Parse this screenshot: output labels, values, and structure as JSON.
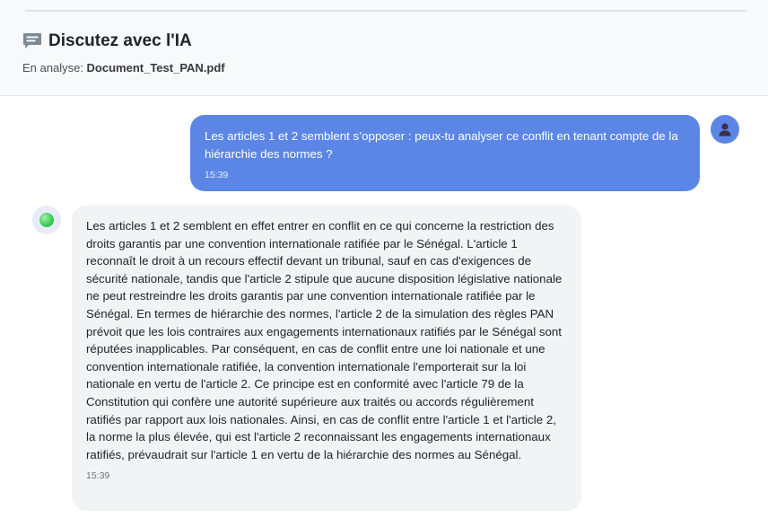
{
  "header": {
    "title": "Discutez avec l'IA",
    "analysis_label": "En analyse: ",
    "document_name": "Document_Test_PAN.pdf",
    "icon": "chat-icon"
  },
  "messages": [
    {
      "role": "user",
      "text": "Les articles 1 et 2 semblent s’opposer : peux-tu analyser ce conflit en tenant compte de la hiérarchie des normes ?",
      "time": "15:39",
      "avatar_icon": "user-avatar-icon"
    },
    {
      "role": "assistant",
      "text": "Les articles 1 et 2 semblent en effet entrer en conflit en ce qui concerne la restriction des droits garantis par une convention internationale ratifiée par le Sénégal. L'article 1 reconnaît le droit à un recours effectif devant un tribunal, sauf en cas d'exigences de sécurité nationale, tandis que l'article 2 stipule que aucune disposition législative nationale ne peut restreindre les droits garantis par une convention internationale ratifiée par le Sénégal. En termes de hiérarchie des normes, l'article 2 de la simulation des règles PAN prévoit que les lois contraires aux engagements internationaux ratifiés par le Sénégal sont réputées inapplicables. Par conséquent, en cas de conflit entre une loi nationale et une convention internationale ratifiée, la convention internationale l'emporterait sur la loi nationale en vertu de l'article 2. Ce principe est en conformité avec l'article 79 de la Constitution qui confère une autorité supérieure aux traités ou accords régulièrement ratifiés par rapport aux lois nationales. Ainsi, en cas de conflit entre l'article 1 et l'article 2, la norme la plus élevée, qui est l'article 2 reconnaissant les engagements internationaux ratifiés, prévaudrait sur l'article 1 en vertu de la hiérarchie des normes au Sénégal.",
      "time": "15:39",
      "avatar_icon": "ai-avatar-icon"
    }
  ],
  "colors": {
    "user_bubble": "#5b86e5",
    "ai_bubble": "#f1f3f5",
    "header_bg": "#f8f9fa",
    "ai_dot": "#3ccf55"
  }
}
